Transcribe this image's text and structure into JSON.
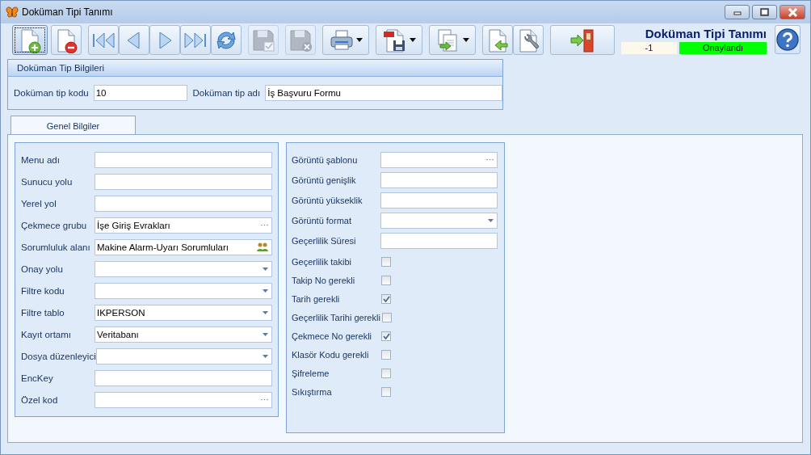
{
  "window": {
    "title": "Doküman Tipi Tanımı"
  },
  "toolbar": [
    [
      {
        "kind": "plain",
        "focused": true,
        "disabled": false
      }
    ],
    [
      {
        "kind": "plain",
        "focused": false,
        "disabled": false
      }
    ],
    [
      {
        "kind": "plain",
        "focused": false,
        "disabled": false
      },
      {
        "kind": "plain",
        "focused": false,
        "disabled": false
      },
      {
        "kind": "plain",
        "focused": false,
        "disabled": false
      },
      {
        "kind": "plain",
        "focused": false,
        "disabled": false
      },
      {
        "kind": "plain",
        "focused": false,
        "disabled": false
      }
    ],
    [
      {
        "kind": "plain",
        "focused": false,
        "disabled": true
      }
    ],
    [
      {
        "kind": "plain",
        "focused": false,
        "disabled": true
      }
    ],
    [
      {
        "kind": "dropdown",
        "focused": false,
        "disabled": false
      }
    ],
    [
      {
        "kind": "dropdown",
        "focused": false,
        "disabled": false
      }
    ],
    [
      {
        "kind": "dropdown",
        "focused": false,
        "disabled": false
      }
    ],
    [
      {
        "kind": "plain",
        "focused": false,
        "disabled": false
      },
      {
        "kind": "plain",
        "focused": false,
        "disabled": false
      }
    ],
    [
      {
        "kind": "wide",
        "focused": false,
        "disabled": false
      }
    ]
  ],
  "header": {
    "title": "Doküman Tipi Tanımı",
    "record": "-1",
    "status": "Onaylandı"
  },
  "info_group": {
    "title": "Doküman Tip Bilgileri",
    "fields": [
      {
        "label": "Doküman tip kodu",
        "value": "10"
      },
      {
        "label": "Doküman tip adı",
        "value": "İş Başvuru Formu"
      }
    ]
  },
  "tabs": [
    {
      "label": "Genel Bilgiler",
      "selected": true
    }
  ],
  "left_fields": [
    {
      "label": "Menu adı",
      "kind": "text"
    },
    {
      "label": "Sunucu yolu",
      "kind": "text"
    },
    {
      "label": "Yerel yol",
      "kind": "text"
    },
    {
      "label": "Çekmece grubu",
      "kind": "lookup",
      "value": "İşe Giriş Evrakları"
    },
    {
      "label": "Sorumluluk alanı",
      "kind": "people",
      "value": "Makine Alarm-Uyarı Sorumluları"
    },
    {
      "label": "Onay yolu",
      "kind": "dropdown"
    },
    {
      "label": "Filtre kodu",
      "kind": "dropdown"
    },
    {
      "label": "Filtre tablo",
      "kind": "dropdown",
      "value": "IKPERSON"
    },
    {
      "label": "Kayıt ortamı",
      "kind": "dropdown",
      "value": "Veritabanı"
    },
    {
      "label": "Dosya düzenleyici",
      "kind": "dropdown"
    },
    {
      "label": "EncKey",
      "kind": "text"
    },
    {
      "label": "Özel kod",
      "kind": "lookup"
    }
  ],
  "right_fields": [
    {
      "label": "Görüntü şablonu",
      "kind": "lookup"
    },
    {
      "label": "Görüntü genişlik",
      "kind": "text"
    },
    {
      "label": "Görüntü yükseklik",
      "kind": "text"
    },
    {
      "label": "Görüntü format",
      "kind": "dropdown"
    },
    {
      "label": "Geçerlilik Süresi",
      "kind": "text"
    },
    {
      "label": "Geçerlilik takibi",
      "kind": "checkbox",
      "checked": false
    },
    {
      "label": "Takip No gerekli",
      "kind": "checkbox",
      "checked": false
    },
    {
      "label": "Tarih gerekli",
      "kind": "checkbox",
      "checked": true
    },
    {
      "label": "Geçerlilik Tarihi gerekli",
      "kind": "checkbox",
      "checked": false
    },
    {
      "label": "Çekmece No gerekli",
      "kind": "checkbox",
      "checked": true
    },
    {
      "label": "Klasör Kodu gerekli",
      "kind": "checkbox",
      "checked": false
    },
    {
      "label": "Şifreleme",
      "kind": "checkbox",
      "checked": false
    },
    {
      "label": "Sıkıştırma",
      "kind": "checkbox",
      "checked": false
    }
  ]
}
